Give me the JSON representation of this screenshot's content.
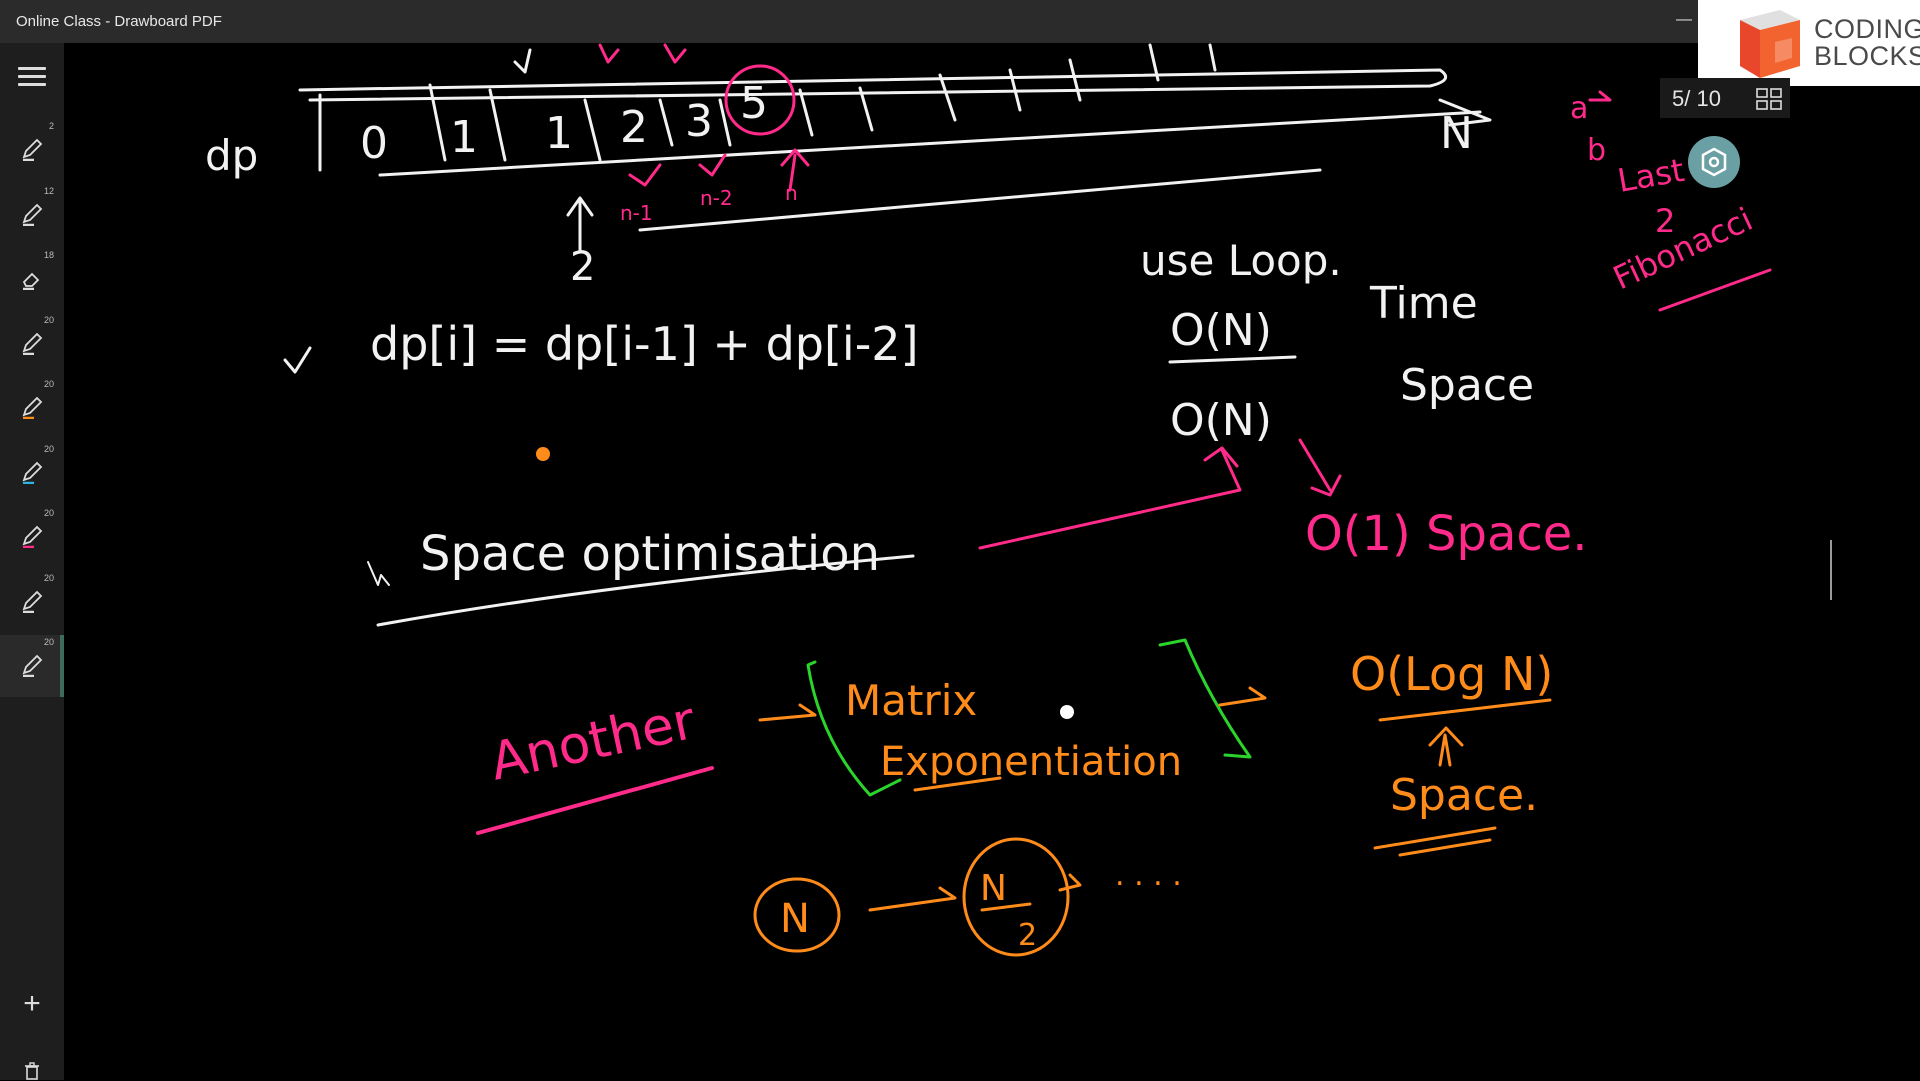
{
  "window": {
    "title": "Online Class - Drawboard PDF",
    "minimize_glyph": "—"
  },
  "sidebar": {
    "tools": [
      {
        "name": "pen-tool-1",
        "size": "2",
        "color": "#dcdcdc"
      },
      {
        "name": "pen-tool-2",
        "size": "12",
        "color": "#dcdcdc"
      },
      {
        "name": "eraser-tool",
        "size": "18",
        "color": "#dcdcdc"
      },
      {
        "name": "pen-tool-white",
        "size": "20",
        "color": "#dcdcdc"
      },
      {
        "name": "pen-tool-orange",
        "size": "20",
        "color": "#ff8c1a"
      },
      {
        "name": "pen-tool-cyan",
        "size": "20",
        "color": "#2fb3e0"
      },
      {
        "name": "pen-tool-pink",
        "size": "20",
        "color": "#ff2a8a"
      },
      {
        "name": "pen-tool-white-2",
        "size": "20",
        "color": "#dcdcdc"
      },
      {
        "name": "pen-tool-green",
        "size": "20",
        "color": "#dcdcdc"
      }
    ],
    "add_glyph": "+"
  },
  "branding": {
    "line1": "CODING",
    "line2": "BLOCKS"
  },
  "pagination": {
    "label": "5/ 10"
  },
  "colors": {
    "ink_white": "#f2f2f2",
    "ink_pink": "#ff2a8a",
    "ink_orange": "#ff8c1a",
    "ink_green": "#2bd42b",
    "accent_teal": "#6aa0a3"
  },
  "handwriting": {
    "dp_label": "dp",
    "array_cells": [
      "0",
      "1",
      "1",
      "2",
      "3",
      "5"
    ],
    "array_end": "N",
    "index_start": "2",
    "marks_nm1": "n-1",
    "marks_nm2": "n-2",
    "marks_n": "n",
    "recurrence": "dp[i] = dp[i-1] + dp[i-2]",
    "use_loop": "use Loop.",
    "time_complexity": "O(N)",
    "time_label": "Time",
    "space_complexity": "O(N)",
    "space_label": "Space",
    "space_opt": "Space optimisation",
    "o1_space": "O(1) Space.",
    "another": "Another",
    "matrix": "Matrix",
    "exponentiation": "Exponentiation",
    "ologn": "O(Log N)",
    "space_dot": "Space.",
    "n_circle": "N",
    "n_over_2": "N",
    "denom": "2",
    "dots": ". . . .",
    "fib_note_a": "a",
    "fib_note_b": "b",
    "fib_note_last": "Last",
    "fib_note_2": "2",
    "fibonacci": "Fibonacci"
  }
}
